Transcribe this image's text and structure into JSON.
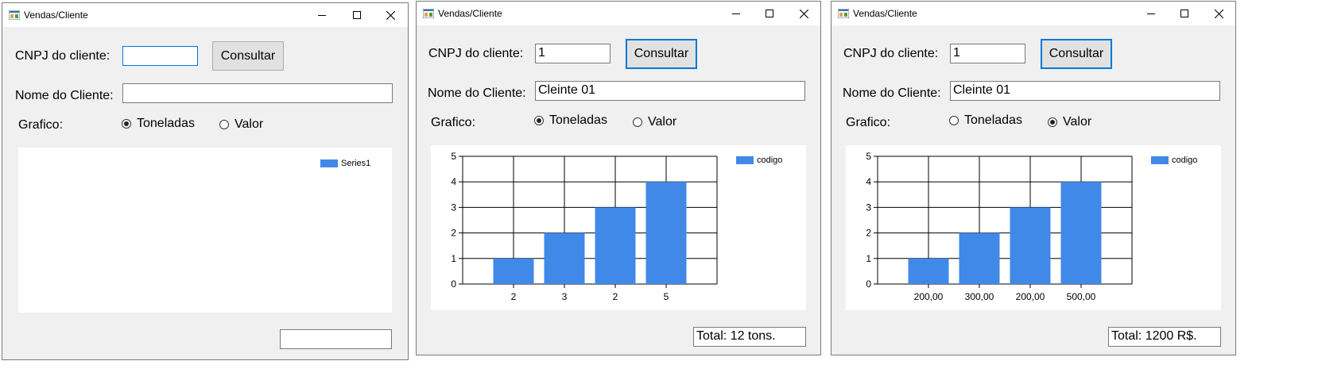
{
  "windows": [
    {
      "title": "Vendas/Cliente",
      "cnpj_label": "CNPJ do cliente:",
      "cnpj_value": "",
      "consultar_label": "Consultar",
      "nome_label": "Nome do Cliente:",
      "nome_value": "",
      "grafico_label": "Grafico:",
      "radio_toneladas_label": "Toneladas",
      "radio_valor_label": "Valor",
      "selected_radio": "toneladas",
      "legend_label": "Series1",
      "total_value": "",
      "chart_data": null
    },
    {
      "title": "Vendas/Cliente",
      "cnpj_label": "CNPJ do cliente:",
      "cnpj_value": "1",
      "consultar_label": "Consultar",
      "nome_label": "Nome do Cliente:",
      "nome_value": "Cleinte 01",
      "grafico_label": "Grafico:",
      "radio_toneladas_label": "Toneladas",
      "radio_valor_label": "Valor",
      "selected_radio": "toneladas",
      "legend_label": "codigo",
      "total_value": "Total: 12 tons.",
      "chart_data": {
        "type": "bar",
        "categories": [
          "2",
          "3",
          "2",
          "5"
        ],
        "series": [
          {
            "name": "codigo",
            "values": [
              1,
              2,
              3,
              4
            ]
          }
        ],
        "yticks": [
          "0",
          "1",
          "2",
          "3",
          "4",
          "5"
        ],
        "ylim": [
          0,
          5
        ],
        "grid": true,
        "legend": "top-right",
        "color": "#4189e8"
      }
    },
    {
      "title": "Vendas/Cliente",
      "cnpj_label": "CNPJ do cliente:",
      "cnpj_value": "1",
      "consultar_label": "Consultar",
      "nome_label": "Nome do Cliente:",
      "nome_value": "Cleinte 01",
      "grafico_label": "Grafico:",
      "radio_toneladas_label": "Toneladas",
      "radio_valor_label": "Valor",
      "selected_radio": "valor",
      "legend_label": "codigo",
      "total_value": "Total: 1200 R$.",
      "chart_data": {
        "type": "bar",
        "categories": [
          "200,00",
          "300,00",
          "200,00",
          "500,00"
        ],
        "series": [
          {
            "name": "codigo",
            "values": [
              1,
              2,
              3,
              4
            ]
          }
        ],
        "yticks": [
          "0",
          "1",
          "2",
          "3",
          "4",
          "5"
        ],
        "ylim": [
          0,
          5
        ],
        "grid": true,
        "legend": "top-right",
        "color": "#4189e8"
      }
    }
  ]
}
